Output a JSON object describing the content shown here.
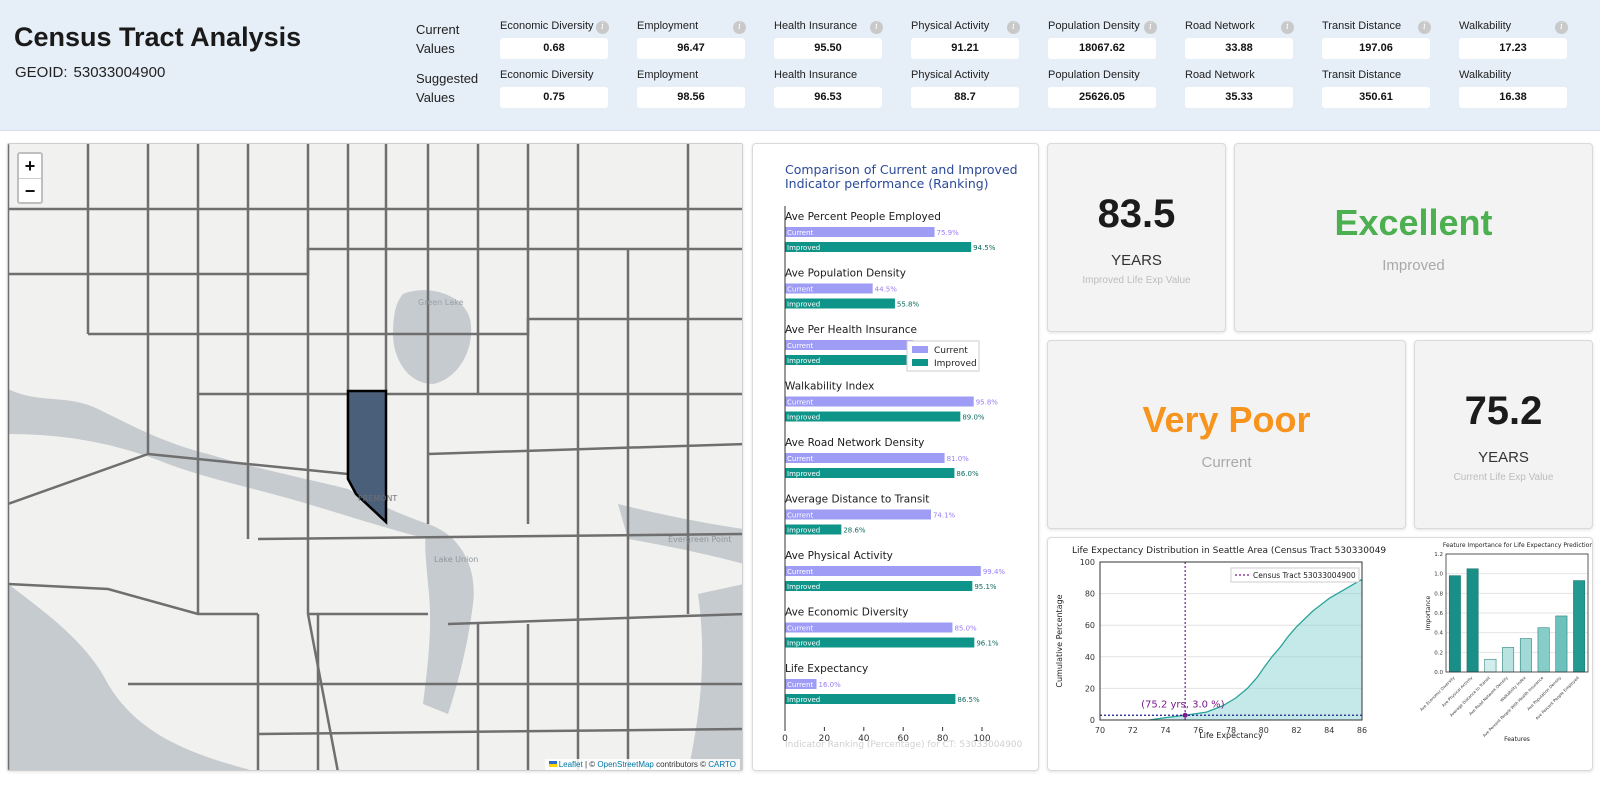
{
  "header": {
    "title": "Census Tract Analysis",
    "geoid_label": "GEOID:",
    "geoid_value": "53033004900",
    "current_label_1": "Current",
    "current_label_2": "Values",
    "suggested_label_1": "Suggested",
    "suggested_label_2": "Values",
    "info_glyph": "i",
    "metrics": [
      {
        "label": "Economic Diversity",
        "current": "0.68",
        "suggested": "0.75"
      },
      {
        "label": "Employment",
        "current": "96.47",
        "suggested": "98.56"
      },
      {
        "label": "Health Insurance",
        "current": "95.50",
        "suggested": "96.53"
      },
      {
        "label": "Physical Activity",
        "current": "91.21",
        "suggested": "88.7"
      },
      {
        "label": "Population Density",
        "current": "18067.62",
        "suggested": "25626.05"
      },
      {
        "label": "Road Network",
        "current": "33.88",
        "suggested": "35.33"
      },
      {
        "label": "Transit Distance",
        "current": "197.06",
        "suggested": "350.61"
      },
      {
        "label": "Walkability",
        "current": "17.23",
        "suggested": "16.38"
      }
    ]
  },
  "map": {
    "zoom_in": "+",
    "zoom_out": "−",
    "labels": [
      "Green Lake",
      "FREMONT",
      "Lake Union",
      "Evergreen Point"
    ],
    "attribution_leaflet": "Leaflet",
    "attribution_sep": "| ©",
    "attribution_osm": "OpenStreetMap",
    "attribution_mid": "contributors ©",
    "attribution_carto": "CARTO",
    "colors": {
      "selected_tract": "#4a5f7a",
      "boundary": "#6f6f6f",
      "water": "#c6cbcf"
    }
  },
  "stats": {
    "improved_value": "83.5",
    "improved_unit": "YEARS",
    "improved_caption": "Improved Life Exp Value",
    "improved_rating": "Excellent",
    "improved_rating_sub": "Improved",
    "current_rating": "Very Poor",
    "current_rating_sub": "Current",
    "current_value": "75.2",
    "current_unit": "YEARS",
    "current_caption": "Current Life Exp Value",
    "colors": {
      "excellent": "#4caf50",
      "very_poor": "#f7941d"
    }
  },
  "chart_data": [
    {
      "type": "bar",
      "orientation": "horizontal",
      "title": "Comparison of Current and Improved Indicator performance (Ranking)",
      "xlabel": "Indicator Ranking (Percentage) for CT: 53033004900",
      "xlim": [
        0,
        100
      ],
      "xticks": [
        0,
        20,
        40,
        60,
        80,
        100
      ],
      "legend": "center-right",
      "categories": [
        "Ave Percent People Employed",
        "Ave Population Density",
        "Ave Per Health Insurance",
        "Walkability Index",
        "Ave Road Network Density",
        "Average Distance to Transit",
        "Ave Physical Activity",
        "Ave Economic Diversity",
        "Life Expectancy"
      ],
      "series": [
        {
          "name": "Current",
          "color": "#9e9cf5",
          "values": [
            75.9,
            44.5,
            65.0,
            95.8,
            81.0,
            74.1,
            99.4,
            85.0,
            16.0
          ],
          "labels": [
            "75.9%",
            "44.5%",
            "",
            "95.8%",
            "81.0%",
            "74.1%",
            "99.4%",
            "85.0%",
            "16.0%"
          ]
        },
        {
          "name": "Improved",
          "color": "#0e9488",
          "values": [
            94.5,
            55.8,
            65.0,
            89.0,
            86.0,
            28.6,
            95.1,
            96.1,
            86.5
          ],
          "labels": [
            "94.5%",
            "55.8%",
            "",
            "89.0%",
            "86.0%",
            "28.6%",
            "95.1%",
            "96.1%",
            "86.5%"
          ]
        }
      ]
    },
    {
      "type": "area",
      "title": "Life Expectancy Distribution in Seattle Area (Census Tract 530330049",
      "xlabel": "Life Expectancy",
      "ylabel": "Cumulative Percentage",
      "xlim": [
        70,
        86
      ],
      "ylim": [
        0,
        100
      ],
      "xticks": [
        70,
        72,
        74,
        76,
        78,
        80,
        82,
        84,
        86
      ],
      "yticks": [
        0,
        20,
        40,
        60,
        80,
        100
      ],
      "legend": "top-right",
      "reference_line": {
        "name": "Census Tract 53033004900",
        "x": 75.2,
        "y": 3.0
      },
      "annotation": "(75.2 yrs, 3.0 %)",
      "series": [
        {
          "name": "cumulative",
          "color": "#7ccfcb",
          "x": [
            73.0,
            74.0,
            75.2,
            76.5,
            77.5,
            78.3,
            79.0,
            79.6,
            80.0,
            80.5,
            81.0,
            81.5,
            82.0,
            82.5,
            83.0,
            83.5,
            84.0,
            84.5,
            85.0,
            85.5,
            86.0
          ],
          "y": [
            0,
            1.5,
            3.0,
            5,
            9,
            14,
            20,
            27,
            33,
            40,
            46,
            53,
            59,
            64,
            69,
            73,
            77,
            80,
            83,
            86,
            89
          ]
        }
      ]
    },
    {
      "type": "bar",
      "title": "Feature Importance for Life Expectancy Prediction",
      "xlabel": "Features",
      "ylabel": "Importance",
      "ylim": [
        0,
        1.2
      ],
      "yticks": [
        0.0,
        0.2,
        0.4,
        0.6,
        0.8,
        1.0,
        1.2
      ],
      "categories": [
        "Ave Economic Diversity",
        "Ave Physical Activity",
        "Average Distance to Transit",
        "Ave Road Network Density",
        "Walkability Index",
        "Ave Percent People With Health Insurance",
        "Ave Population Density",
        "Ave Percent People Employed"
      ],
      "values": [
        0.98,
        1.05,
        0.13,
        0.25,
        0.34,
        0.45,
        0.57,
        0.93
      ],
      "colors": [
        "#1a8f87",
        "#1a8f87",
        "#d2eeec",
        "#b9e3e1",
        "#a1d9d6",
        "#86cdc9",
        "#6cc1bc",
        "#239a91"
      ]
    }
  ]
}
